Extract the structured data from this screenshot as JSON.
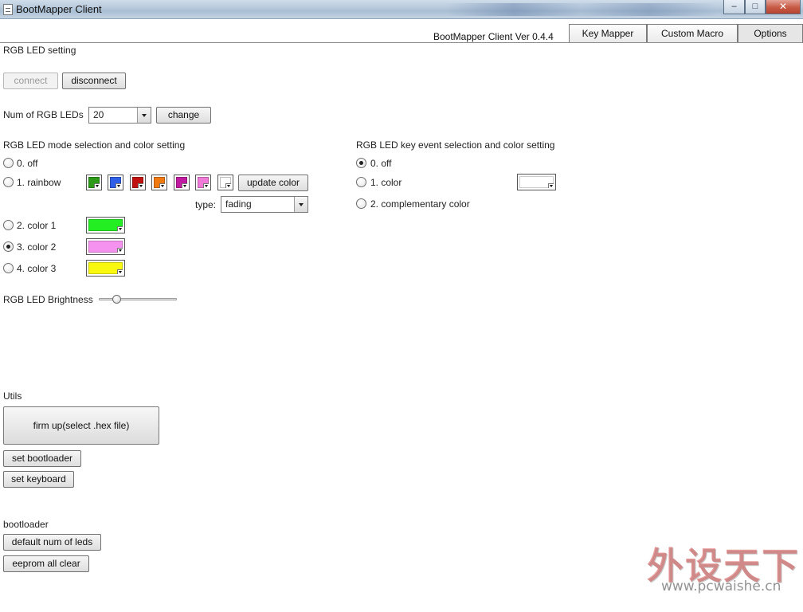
{
  "window": {
    "title": "BootMapper Client",
    "controls": {
      "minimize": "–",
      "maximize": "□",
      "close": "✕"
    }
  },
  "header": {
    "version": "BootMapper Client Ver 0.4.4",
    "tabs": [
      {
        "label": "Key Mapper",
        "active": false
      },
      {
        "label": "Custom Macro",
        "active": false
      },
      {
        "label": "Options",
        "active": true
      }
    ]
  },
  "rgb_setting": {
    "title": "RGB LED setting",
    "connect_label": "connect",
    "disconnect_label": "disconnect"
  },
  "num_leds": {
    "label": "Num of RGB LEDs",
    "value": "20",
    "change_label": "change"
  },
  "mode_section": {
    "title": "RGB LED mode selection and color setting",
    "options": [
      {
        "label": "0. off",
        "checked": false
      },
      {
        "label": "1. rainbow",
        "checked": false
      },
      {
        "label": "2. color 1",
        "checked": false
      },
      {
        "label": "3. color 2",
        "checked": true
      },
      {
        "label": "4. color 3",
        "checked": false
      }
    ],
    "rainbow_colors": [
      "#2e9a1a",
      "#2e5fe8",
      "#c01010",
      "#f07a10",
      "#c01aa0",
      "#f07ad8",
      "#ffffff"
    ],
    "update_color_label": "update color",
    "type_label": "type:",
    "type_value": "fading",
    "color1": "#22ee22",
    "color2": "#f592ef",
    "color3": "#f9f90f"
  },
  "key_event_section": {
    "title": "RGB LED key event selection and color setting",
    "options": [
      {
        "label": "0. off",
        "checked": true
      },
      {
        "label": "1. color",
        "checked": false
      },
      {
        "label": "2. complementary color",
        "checked": false
      }
    ],
    "color": "#ffffff"
  },
  "brightness": {
    "label": "RGB LED Brightness",
    "value_fraction": 0.2
  },
  "utils": {
    "title": "Utils",
    "firmup_label": "firm up(select .hex file)",
    "set_bootloader_label": "set bootloader",
    "set_keyboard_label": "set keyboard"
  },
  "bootloader": {
    "title": "bootloader",
    "default_leds_label": "default num of leds",
    "eeprom_clear_label": "eeprom all clear"
  },
  "watermark": {
    "logo_text": "外设天下",
    "url": "www.pcwaishe.cn"
  }
}
